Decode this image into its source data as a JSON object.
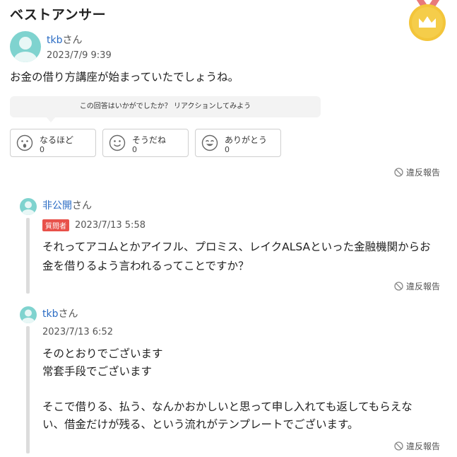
{
  "section_title": "ベストアンサー",
  "best_answer": {
    "user": "tkb",
    "honorific": "さん",
    "date": "2023/7/9 9:39",
    "text": "お金の借り方講座が始まっていたでしょうね。",
    "reaction_prompt": "この回答はいかがでしたか？ リアクションしてみよう",
    "reactions": [
      {
        "label": "なるほど",
        "count": "0",
        "icon": "surprised-face-icon"
      },
      {
        "label": "そうだね",
        "count": "0",
        "icon": "smile-face-icon"
      },
      {
        "label": "ありがとう",
        "count": "0",
        "icon": "happy-face-icon"
      }
    ],
    "report": "違反報告"
  },
  "replies": [
    {
      "user": "非公開",
      "honorific": "さん",
      "badge": "質問者",
      "date": "2023/7/13 5:58",
      "lines": [
        "それってアコムとかアイフル、プロミス、レイクALSAといった金融機関からお",
        "金を借りるよう言われるってことですか？"
      ],
      "report": "違反報告"
    },
    {
      "user": "tkb",
      "honorific": "さん",
      "date": "2023/7/13 6:52",
      "lines": [
        "そのとおりでございます",
        "常套手段でございます",
        "",
        "そこで借りる、払う、なんかおかしいと思って申し入れても返してもらえな",
        "い、借金だけが残る、という流れがテンプレートでございます。"
      ],
      "report": "違反報告"
    }
  ],
  "colors": {
    "accent_link": "#2b6cc4",
    "badge": "#e8514a",
    "avatar": "#7fd3cf",
    "medal": "#f3c53a"
  }
}
